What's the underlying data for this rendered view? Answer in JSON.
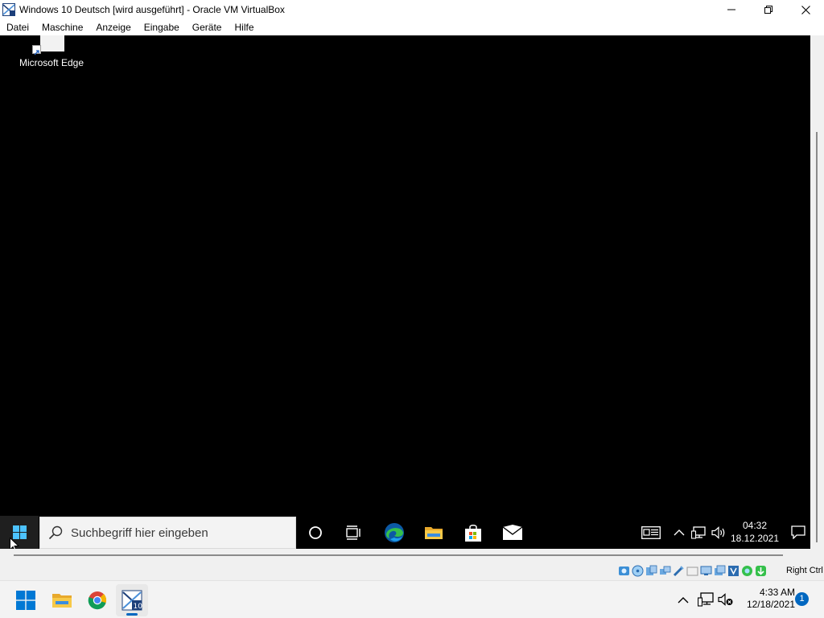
{
  "window": {
    "title": "Windows 10 Deutsch [wird ausgeführt] - Oracle VM VirtualBox"
  },
  "menubar": {
    "items": [
      "Datei",
      "Maschine",
      "Anzeige",
      "Eingabe",
      "Geräte",
      "Hilfe"
    ]
  },
  "guest": {
    "desktop_icon_label": "Microsoft Edge",
    "search_placeholder": "Suchbegriff hier eingeben",
    "clock_time": "04:32",
    "clock_date": "18.12.2021"
  },
  "statusbar": {
    "host_key": "Right Ctrl"
  },
  "host": {
    "clock_time": "4:33 AM",
    "clock_date": "12/18/2021",
    "notification_count": "1"
  },
  "colors": {
    "guest_bg": "#000000",
    "host_accent": "#0067c0",
    "edge_blue": "#0c59a4",
    "edge_green": "#35c04b"
  }
}
